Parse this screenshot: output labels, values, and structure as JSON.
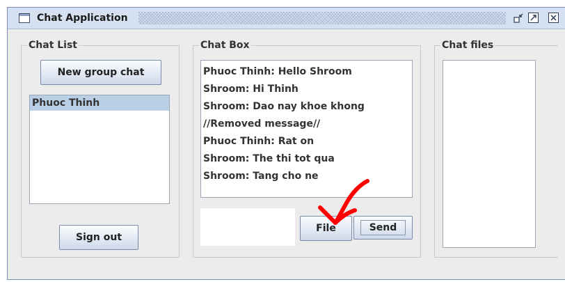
{
  "window": {
    "title": "Chat Application"
  },
  "chat_list": {
    "label": "Chat List",
    "new_group_button": "New group chat",
    "items": [
      "Phuoc Thinh"
    ],
    "sign_out_button": "Sign out"
  },
  "chat_box": {
    "label": "Chat Box",
    "messages": [
      "Phuoc Thinh: Hello Shroom",
      "Shroom: Hi Thinh",
      "Shroom: Dao nay khoe khong",
      "//Removed message//",
      "Phuoc Thinh: Rat on",
      "Shroom: The thi tot qua",
      "Shroom: Tang cho ne"
    ],
    "input_value": "",
    "file_button": "File",
    "send_button": "Send"
  },
  "chat_files": {
    "label": "Chat files"
  },
  "colors": {
    "titlebar": "#d5e1f1",
    "selection": "#b8cfe5",
    "annotation": "#ff0000"
  }
}
